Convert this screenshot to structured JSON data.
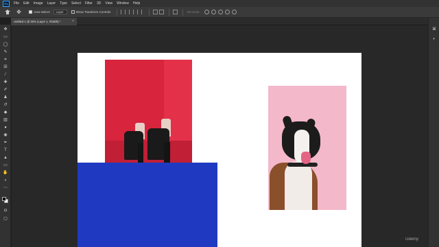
{
  "app": {
    "logo_text": "Ps"
  },
  "menu": [
    "File",
    "Edit",
    "Image",
    "Layer",
    "Type",
    "Select",
    "Filter",
    "3D",
    "View",
    "Window",
    "Help"
  ],
  "options_bar": {
    "auto_select_label": "Auto-Select:",
    "auto_select_checked": true,
    "layer_dropdown": "Layer",
    "show_transform_label": "Show Transform Controls",
    "show_transform_checked": false,
    "mode_3d_label": "3D Mode:"
  },
  "document_tab": {
    "title": "Untitled-1 @ 50% (Layer 1, RGB/8) *",
    "close": "×"
  },
  "watermark": "Udemy",
  "colors": {
    "foreground": "#000000",
    "background": "#ffffff",
    "blue_block": "#1f3ac1",
    "boots_bg": "#d8243d",
    "dog_bg": "#f3b8c9"
  }
}
